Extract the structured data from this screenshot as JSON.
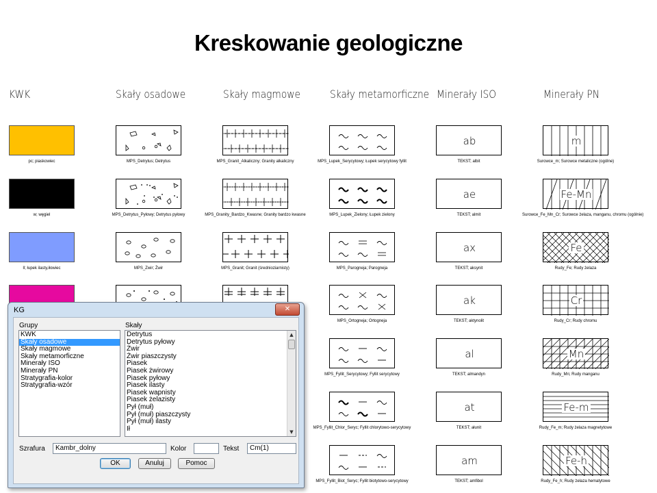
{
  "title": "Kreskowanie geologiczne",
  "columns": [
    {
      "heading": "KWK"
    },
    {
      "heading": "Skały osadowe"
    },
    {
      "heading": "Skały magmowe"
    },
    {
      "heading": "Skały metamorficzne"
    },
    {
      "heading": "Minerały ISO"
    },
    {
      "heading": "Minerały PN"
    }
  ],
  "kwk": [
    {
      "color": "#ffc000",
      "caption": "pc; piaskowiec"
    },
    {
      "color": "#000000",
      "caption": "w; węgiel"
    },
    {
      "color": "#7f9cff",
      "caption": "ll; łupek ilasty,iłowiec"
    },
    {
      "color": "#e6099f",
      "caption": ""
    }
  ],
  "osadowe": [
    {
      "pattern": "detrytus",
      "caption": "MPS_Detrytus; Detrytus"
    },
    {
      "pattern": "detrytus-pylowy",
      "caption": "MPS_Detrytus_Pyłowy; Detrytus pyłowy"
    },
    {
      "pattern": "zwir",
      "caption": "MPS_Zwir; Żwir"
    },
    {
      "pattern": "zwir-piaszczysty",
      "caption": ""
    }
  ],
  "magmowe": [
    {
      "pattern": "granit-alkaliczny",
      "caption": "MPS_Granit_Alkaliczny; Granity alkaliczny"
    },
    {
      "pattern": "granity-kwasne",
      "caption": "MPS_Granity_Bardzo_Kwasne; Granity bardzo kwasne"
    },
    {
      "pattern": "granit",
      "caption": "MPS_Granit; Granit (średnioziarnisty)"
    },
    {
      "pattern": "granit-double",
      "caption": ""
    }
  ],
  "metamorficzne": [
    {
      "pattern": "tilde3",
      "caption": "MPS_Lupek_Serycytowy; Łupek serycytowy fyllit"
    },
    {
      "pattern": "tilde3-bold",
      "caption": "MPS_Lupek_Zielony; Łupek zielony"
    },
    {
      "pattern": "tilde-eq",
      "caption": "MPS_Parogneja; Parogneja"
    },
    {
      "pattern": "tilde-x",
      "caption": "MPS_Ortogneja; Ortogneja"
    },
    {
      "pattern": "tilde-dash",
      "caption": "MPS_Fyllit_Serycytowy; Fyllit serycytowy"
    },
    {
      "pattern": "tilde-dash-bold",
      "caption": "MPS_Fyllit_Chlor_Seryc; Fyllit chlorytowo-serycytowy"
    },
    {
      "pattern": "dash-tilde",
      "caption": "MPS_Fyllit_Biot_Seryc; Fyllit biotytowo-serycytowy"
    }
  ],
  "iso": [
    {
      "text": "ab",
      "caption": "TEKST; albit"
    },
    {
      "text": "ae",
      "caption": "TEKST; almit"
    },
    {
      "text": "ax",
      "caption": "TEKST; aksynit"
    },
    {
      "text": "ak",
      "caption": "TEKST; aktynolit"
    },
    {
      "text": "al",
      "caption": "TEKST; almandyn"
    },
    {
      "text": "at",
      "caption": "TEKST; ałunit"
    },
    {
      "text": "am",
      "caption": "TEKST; amfibol"
    }
  ],
  "pn": [
    {
      "text": "m",
      "pattern": "vlines",
      "caption": "Surowce_m; Surowce metaliczne (ogólne)"
    },
    {
      "text": "Fe-Mn",
      "pattern": "vlines-diag",
      "caption": "Surowce_Fe_Mn_Cr; Surowce żelaza, manganu, chromu (ogólnie)"
    },
    {
      "text": "Fe",
      "pattern": "crosshatch",
      "caption": "Rudy_Fe; Rudy żelaza"
    },
    {
      "text": "Cr",
      "pattern": "grid",
      "caption": "Rudy_Cr; Rudy chromu"
    },
    {
      "text": "Mn",
      "pattern": "grid-diag",
      "caption": "Rudy_Mn; Rudy manganu"
    },
    {
      "text": "Fe-m",
      "pattern": "hlines",
      "caption": "Rudy_Fe_m; Rudy żelaza magnetytowe"
    },
    {
      "text": "Fe-h",
      "pattern": "diag-vlines",
      "caption": "Rudy_Fe_h; Rudy żelaza hematytowe"
    }
  ],
  "dialog": {
    "title": "KG",
    "close_symbol": "✕",
    "groups_label": "Grupy",
    "groups": [
      "KWK",
      "Skały osadowe",
      "Skały magmowe",
      "Skały metamorficzne",
      "Minerały ISO",
      "Minerały PN",
      "Stratygrafia-kolor",
      "Stratygrafia-wzór"
    ],
    "groups_selected": 1,
    "scales_label": "Skały",
    "scales": [
      "Detrytus",
      "Detrytus pyłowy",
      "Żwir",
      "Żwir piaszczysty",
      "Piasek",
      "Piasek żwirowy",
      "Piasek pyłowy",
      "Piasek ilasty",
      "Piasek wapnisty",
      "Piasek żelazisty",
      "Pył (muł)",
      "Pył (muł) piaszczysty",
      "Pył (muł) ilasty",
      "Ił"
    ],
    "szrafura_label": "Szrafura",
    "szrafura_value": "Kambr_dolny",
    "kolor_label": "Kolor",
    "kolor_value": "",
    "tekst_label": "Tekst",
    "tekst_value": "Cm(1)",
    "ok_label": "OK",
    "cancel_label": "Anuluj",
    "help_label": "Pomoc"
  }
}
